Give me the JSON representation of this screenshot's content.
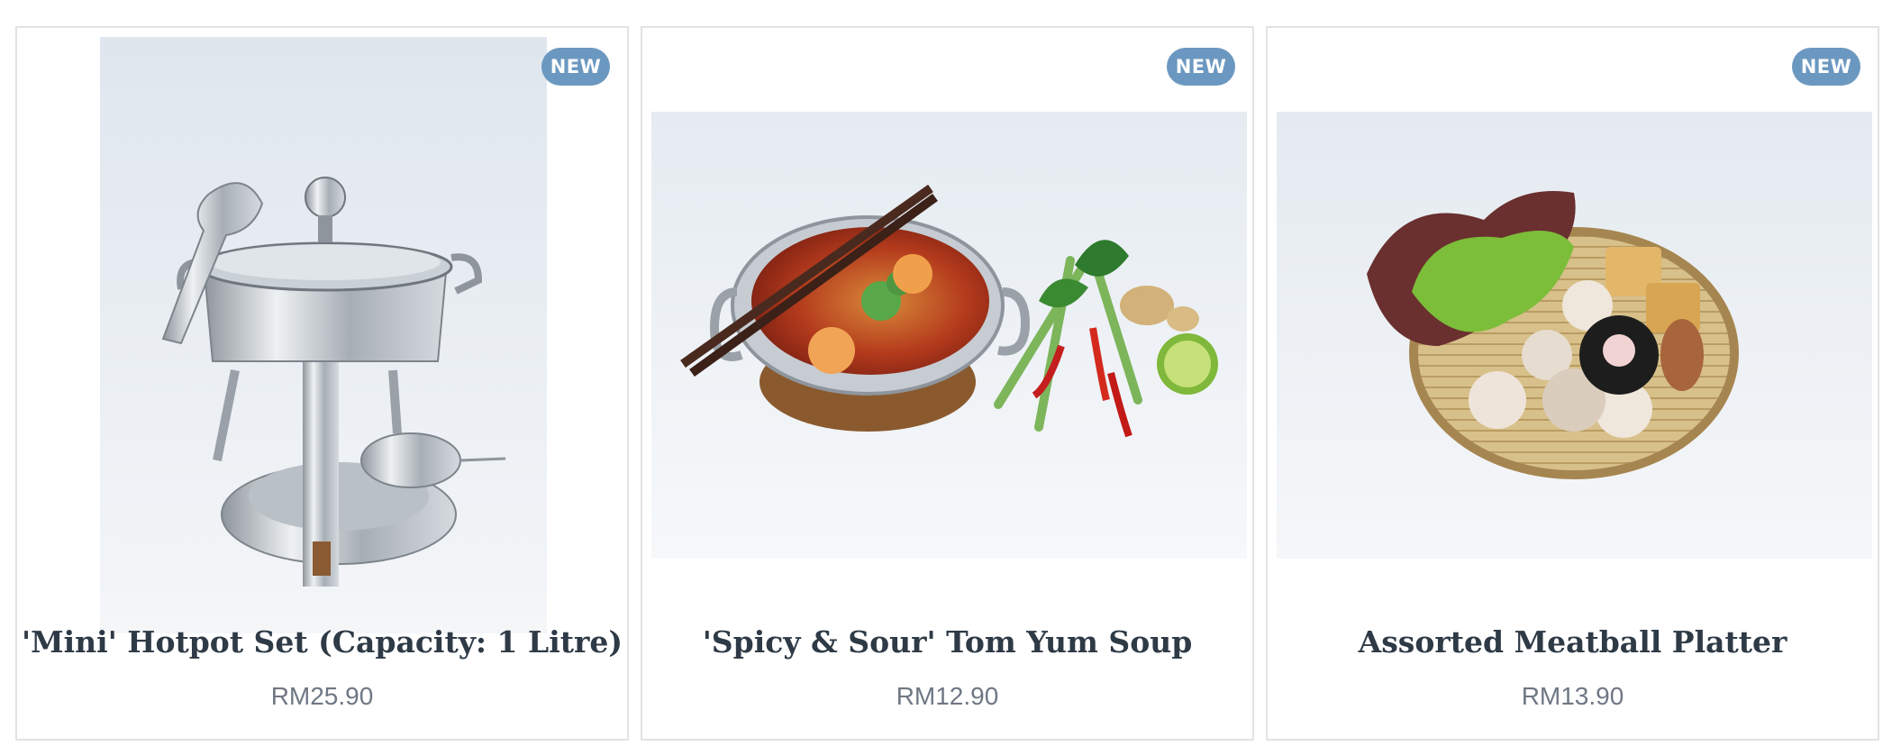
{
  "products": [
    {
      "badge": "NEW",
      "title": "'Mini' Hotpot Set (Capacity: 1 Litre)",
      "price": "RM25.90",
      "image_icon": "hotpot-set-photo"
    },
    {
      "badge": "NEW",
      "title": "'Spicy & Sour' Tom Yum Soup",
      "price": "RM12.90",
      "image_icon": "tom-yum-soup-photo"
    },
    {
      "badge": "NEW",
      "title": "Assorted Meatball Platter",
      "price": "RM13.90",
      "image_icon": "meatball-platter-photo"
    }
  ],
  "colors": {
    "badge": "#6b98c0",
    "title": "#2e3a46",
    "price": "#6f7784",
    "border": "#e3e3e3"
  }
}
